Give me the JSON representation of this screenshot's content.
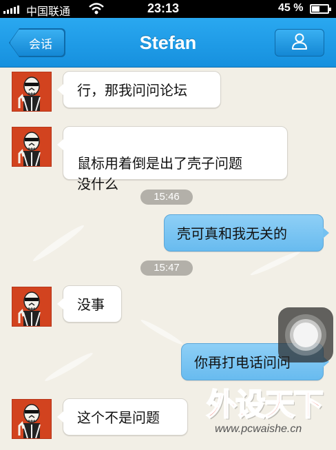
{
  "status_bar": {
    "carrier": "中国联通",
    "time": "23:13",
    "battery": "45 %",
    "battery_level": 0.45
  },
  "nav": {
    "back_label": "会话",
    "title": "Stefan"
  },
  "messages": [
    {
      "side": "in",
      "text": "行，那我问问论坛"
    },
    {
      "side": "in",
      "text": "鼠标用着倒是出了壳子问题\n没什么"
    },
    {
      "type": "time",
      "text": "15:46"
    },
    {
      "side": "out",
      "text": "壳可真和我无关的"
    },
    {
      "type": "time",
      "text": "15:47"
    },
    {
      "side": "in",
      "text": "没事"
    },
    {
      "side": "out",
      "text": "你再打电话问问"
    },
    {
      "side": "in",
      "text": "这个不是问题"
    }
  ],
  "watermark": {
    "logo_text": "外设天下",
    "url": "www.pcwaishe.cn"
  },
  "colors": {
    "nav_blue": "#1f9ce8",
    "outgoing_bubble": "#74c1f1",
    "incoming_bubble": "#ffffff",
    "chat_background": "#f2efe6",
    "avatar_red": "#d2431f"
  }
}
